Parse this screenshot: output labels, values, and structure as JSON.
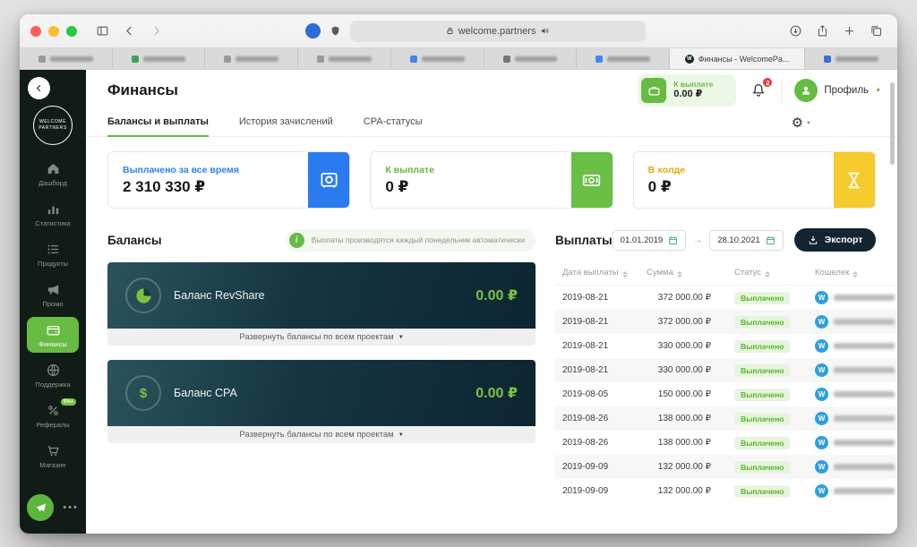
{
  "browser": {
    "address": "welcome.partners",
    "tabs": [
      {
        "favicon": "#9a9a9a"
      },
      {
        "favicon": "#36a854"
      },
      {
        "favicon": "#9a9a9a"
      },
      {
        "favicon": "#9a9a9a"
      },
      {
        "favicon": "#4285f4"
      },
      {
        "favicon": "#777777"
      },
      {
        "favicon": "#4285f4"
      },
      {
        "favicon": "wp",
        "title": "Финансы - WelcomePa...",
        "active": true
      },
      {
        "favicon": "#3b6fd4"
      }
    ]
  },
  "sidebar": {
    "logo_line1": "WELCOME",
    "logo_line2": "PARTNERS",
    "items": [
      {
        "key": "dashboard",
        "icon": "home",
        "label": "Дашборд"
      },
      {
        "key": "stats",
        "icon": "bar-chart",
        "label": "Статистика"
      },
      {
        "key": "products",
        "icon": "list",
        "label": "Продукты"
      },
      {
        "key": "promo",
        "icon": "megaphone",
        "label": "Промо"
      },
      {
        "key": "finance",
        "icon": "wallet",
        "label": "Финансы",
        "active": true
      },
      {
        "key": "support",
        "icon": "globe",
        "label": "Поддержка"
      },
      {
        "key": "referrals",
        "icon": "percent",
        "label": "Рефералы",
        "badge": "5%+"
      },
      {
        "key": "shop",
        "icon": "cart",
        "label": "Магазин"
      }
    ]
  },
  "header": {
    "title": "Финансы",
    "payout_label": "К выплате",
    "payout_value": "0.00 ₽",
    "notifications": "2",
    "profile": "Профиль"
  },
  "page_tabs": [
    {
      "key": "balances",
      "label": "Балансы и выплаты",
      "active": true
    },
    {
      "key": "history",
      "label": "История зачислений"
    },
    {
      "key": "cpa",
      "label": "CPA-статусы"
    }
  ],
  "stat_cards": [
    {
      "key": "paid-total",
      "icon": "safe",
      "label": "Выплачено за все время",
      "value": "2 310 330 ₽",
      "accent": "#2f80ed",
      "panel": "#2a7bf0"
    },
    {
      "key": "payable",
      "icon": "cash",
      "label": "К выплате",
      "value": "0 ₽",
      "accent": "#64b83e",
      "panel": "#6abf45"
    },
    {
      "key": "hold",
      "icon": "hourglass",
      "label": "В холде",
      "value": "0 ₽",
      "accent": "#dfae00",
      "panel": "#f6cb2e"
    }
  ],
  "balances": {
    "heading": "Балансы",
    "info": "Выплаты производятся каждый понедельник автоматически",
    "cards": [
      {
        "key": "revshare",
        "icon": "pie",
        "title": "Баланс RevShare",
        "value": "0.00 ₽",
        "expand": "Развернуть балансы по всем проектам"
      },
      {
        "key": "cpa",
        "icon": "dollar",
        "title": "Баланс CPA",
        "value": "0.00 ₽",
        "expand": "Развернуть балансы по всем проектам"
      }
    ]
  },
  "payouts": {
    "heading": "Выплаты",
    "date_from": "01.01.2019",
    "date_to": "28.10.2021",
    "export_label": "Экспорт",
    "columns": [
      "Дата выплаты",
      "Сумма",
      "Статус",
      "Кошелек"
    ],
    "rows": [
      {
        "date": "2019-08-21",
        "amount": "372 000.00 ₽",
        "status": "Выплачено"
      },
      {
        "date": "2019-08-21",
        "amount": "372 000.00 ₽",
        "status": "Выплачено"
      },
      {
        "date": "2019-08-21",
        "amount": "330 000.00 ₽",
        "status": "Выплачено"
      },
      {
        "date": "2019-08-21",
        "amount": "330 000.00 ₽",
        "status": "Выплачено"
      },
      {
        "date": "2019-08-05",
        "amount": "150 000.00 ₽",
        "status": "Выплачено"
      },
      {
        "date": "2019-08-26",
        "amount": "138 000.00 ₽",
        "status": "Выплачено"
      },
      {
        "date": "2019-08-26",
        "amount": "138 000.00 ₽",
        "status": "Выплачено"
      },
      {
        "date": "2019-09-09",
        "amount": "132 000.00 ₽",
        "status": "Выплачено"
      },
      {
        "date": "2019-09-09",
        "amount": "132 000.00 ₽",
        "status": "Выплачено"
      }
    ]
  }
}
